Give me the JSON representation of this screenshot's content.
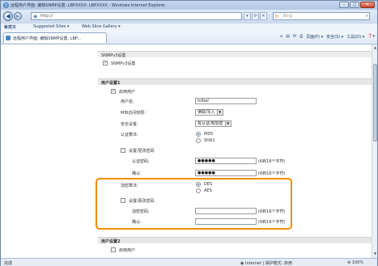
{
  "window": {
    "title": "远程用户界面: 编辑SNMP设置: LBPXXXX: LBPXXXX - Windows Internet Explorer",
    "buttons": {
      "minimize": "–",
      "maximize": "□",
      "close": "✕"
    }
  },
  "address_bar": {
    "url": "http://",
    "search_placeholder": "Bing"
  },
  "favorites_bar": {
    "favorites_label": "收藏夹",
    "suggested_sites": "Suggested Sites ▾",
    "web_slice_gallery": "Web Slice Gallery ▾"
  },
  "tab": {
    "label": "远程用户界面: 编辑SNMP设置: LBP..."
  },
  "command_bar": {
    "home": "⌂",
    "feeds": "▤",
    "mail": "✉",
    "print": "⎙",
    "page": "页面(P) ▾",
    "safety": "安全(S) ▾",
    "tools": "工具(O) ▾",
    "help": "❓▾"
  },
  "page": {
    "snmpv3_header": "SNMPv3设置",
    "use_snmpv3": "使用SNMPv3",
    "user1": {
      "title": "用户设置1",
      "enable_user": "启用用户",
      "username_label": "用户名:",
      "username_value": "initial",
      "mib_access_label": "MIB访问权限:",
      "mib_access_value": "读取/写入",
      "security_label": "安全设置:",
      "security_value": "有认证/有加密",
      "auth_algorithm_label": "认证算法:",
      "auth_options": [
        "MD5",
        "SHA1"
      ],
      "set_change_password_auth": "设置/更改密码",
      "auth_password_label": "认证密码:",
      "auth_password_value": "●●●●●",
      "auth_password_hint": "(6到16个字符)",
      "confirm_label": "确认:",
      "confirm_value": "●●●●●",
      "confirm_hint": "(6到16个字符)",
      "encryption_algorithm_label": "加密算法:",
      "encryption_options": [
        "DES",
        "AES"
      ],
      "set_change_password_enc": "设置/更改密码",
      "enc_password_label": "加密密码:",
      "enc_password_hint": "(6到16个字符)",
      "enc_confirm_label": "确认:",
      "enc_confirm_hint": "(6到16个字符)"
    },
    "user2": {
      "title": "用户设置2",
      "enable_user": "启用用户"
    }
  },
  "status_bar": {
    "done": "完成",
    "zone": "Internet | 保护模式: 启用",
    "zoom": "100%"
  }
}
